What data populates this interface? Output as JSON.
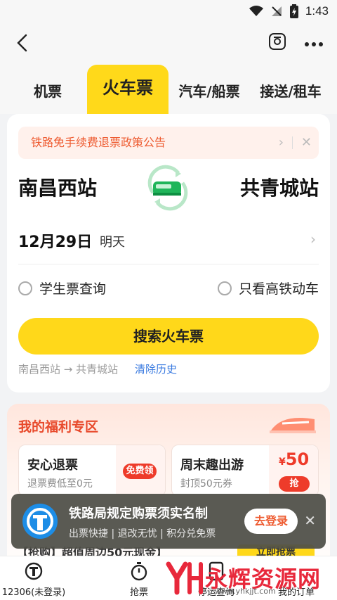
{
  "status_bar": {
    "time": "1:43"
  },
  "tabs": [
    {
      "label": "机票"
    },
    {
      "label": "火车票"
    },
    {
      "label": "汽车/船票"
    },
    {
      "label": "接送/租车"
    }
  ],
  "notice": {
    "text": "铁路免手续费退票政策公告"
  },
  "route": {
    "from": "南昌西站",
    "to": "共青城站"
  },
  "date": {
    "main": "12月29日",
    "sub": "明天"
  },
  "options": {
    "student": "学生票查询",
    "highspeed": "只看高铁动车"
  },
  "search": {
    "label": "搜索火车票"
  },
  "history": {
    "item": "南昌西站 → 共青城站",
    "clear": "清除历史"
  },
  "welfare": {
    "title": "我的福利专区",
    "cards": [
      {
        "title": "安心退票",
        "sub": "退票费低至0元",
        "badge": "免费领"
      },
      {
        "title": "周末趣出游",
        "sub": "封顶50元券",
        "price_symbol": "¥",
        "price": "50",
        "badge": "抢"
      }
    ]
  },
  "promo": {
    "text": "【抢购】超值周边50元现金】",
    "cta": "立即抢票"
  },
  "toast": {
    "title": "铁路局规定购票须实名制",
    "sub": "出票快捷 | 退改无忧 | 积分兑免票",
    "button": "去登录"
  },
  "bottom_nav": [
    {
      "label": "12306(未登录)"
    },
    {
      "label": "抢票"
    },
    {
      "label": "停运查询"
    },
    {
      "label": "我的订单"
    }
  ],
  "watermark": {
    "text": "永辉资源网",
    "url": "www.yhkjjt.com"
  },
  "colors": {
    "accent": "#ffd81a",
    "notice": "#ee5a2f",
    "link": "#3b7be0",
    "red": "#ee3b2a"
  }
}
